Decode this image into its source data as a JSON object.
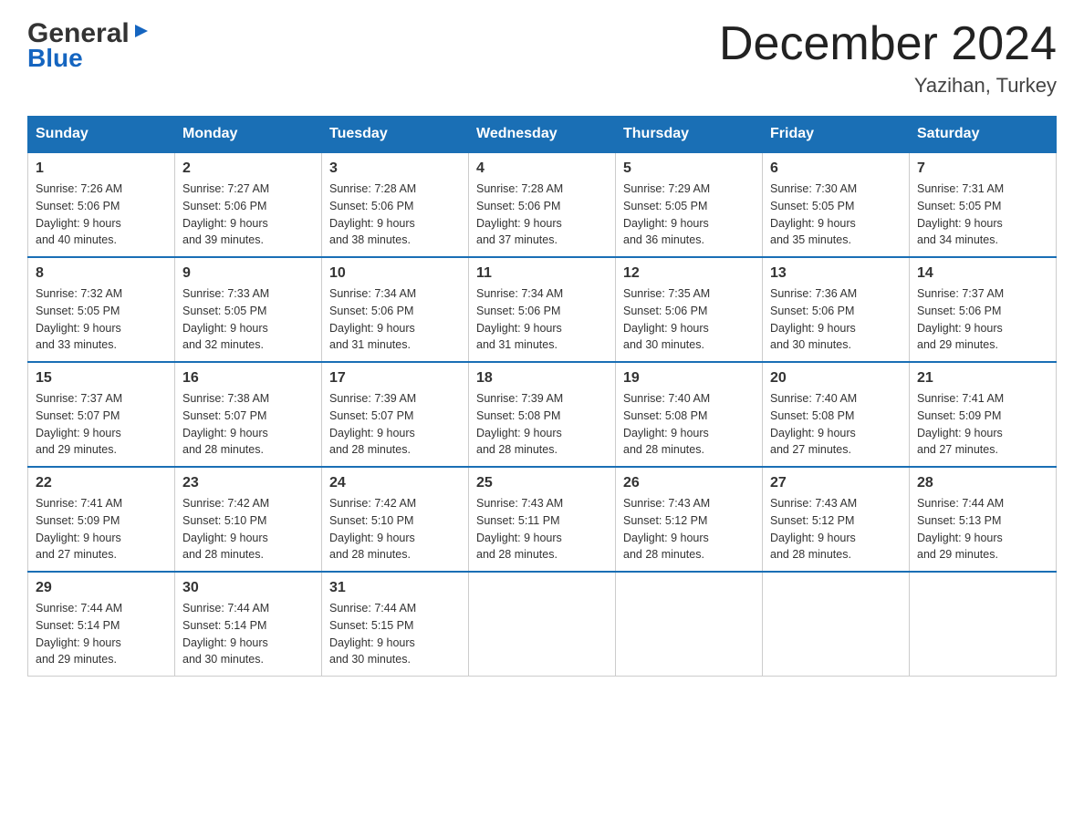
{
  "logo": {
    "general": "General",
    "blue": "Blue"
  },
  "header": {
    "title": "December 2024",
    "subtitle": "Yazihan, Turkey"
  },
  "weekdays": [
    "Sunday",
    "Monday",
    "Tuesday",
    "Wednesday",
    "Thursday",
    "Friday",
    "Saturday"
  ],
  "weeks": [
    [
      {
        "day": "1",
        "sunrise": "7:26 AM",
        "sunset": "5:06 PM",
        "daylight": "9 hours and 40 minutes."
      },
      {
        "day": "2",
        "sunrise": "7:27 AM",
        "sunset": "5:06 PM",
        "daylight": "9 hours and 39 minutes."
      },
      {
        "day": "3",
        "sunrise": "7:28 AM",
        "sunset": "5:06 PM",
        "daylight": "9 hours and 38 minutes."
      },
      {
        "day": "4",
        "sunrise": "7:28 AM",
        "sunset": "5:06 PM",
        "daylight": "9 hours and 37 minutes."
      },
      {
        "day": "5",
        "sunrise": "7:29 AM",
        "sunset": "5:05 PM",
        "daylight": "9 hours and 36 minutes."
      },
      {
        "day": "6",
        "sunrise": "7:30 AM",
        "sunset": "5:05 PM",
        "daylight": "9 hours and 35 minutes."
      },
      {
        "day": "7",
        "sunrise": "7:31 AM",
        "sunset": "5:05 PM",
        "daylight": "9 hours and 34 minutes."
      }
    ],
    [
      {
        "day": "8",
        "sunrise": "7:32 AM",
        "sunset": "5:05 PM",
        "daylight": "9 hours and 33 minutes."
      },
      {
        "day": "9",
        "sunrise": "7:33 AM",
        "sunset": "5:05 PM",
        "daylight": "9 hours and 32 minutes."
      },
      {
        "day": "10",
        "sunrise": "7:34 AM",
        "sunset": "5:06 PM",
        "daylight": "9 hours and 31 minutes."
      },
      {
        "day": "11",
        "sunrise": "7:34 AM",
        "sunset": "5:06 PM",
        "daylight": "9 hours and 31 minutes."
      },
      {
        "day": "12",
        "sunrise": "7:35 AM",
        "sunset": "5:06 PM",
        "daylight": "9 hours and 30 minutes."
      },
      {
        "day": "13",
        "sunrise": "7:36 AM",
        "sunset": "5:06 PM",
        "daylight": "9 hours and 30 minutes."
      },
      {
        "day": "14",
        "sunrise": "7:37 AM",
        "sunset": "5:06 PM",
        "daylight": "9 hours and 29 minutes."
      }
    ],
    [
      {
        "day": "15",
        "sunrise": "7:37 AM",
        "sunset": "5:07 PM",
        "daylight": "9 hours and 29 minutes."
      },
      {
        "day": "16",
        "sunrise": "7:38 AM",
        "sunset": "5:07 PM",
        "daylight": "9 hours and 28 minutes."
      },
      {
        "day": "17",
        "sunrise": "7:39 AM",
        "sunset": "5:07 PM",
        "daylight": "9 hours and 28 minutes."
      },
      {
        "day": "18",
        "sunrise": "7:39 AM",
        "sunset": "5:08 PM",
        "daylight": "9 hours and 28 minutes."
      },
      {
        "day": "19",
        "sunrise": "7:40 AM",
        "sunset": "5:08 PM",
        "daylight": "9 hours and 28 minutes."
      },
      {
        "day": "20",
        "sunrise": "7:40 AM",
        "sunset": "5:08 PM",
        "daylight": "9 hours and 27 minutes."
      },
      {
        "day": "21",
        "sunrise": "7:41 AM",
        "sunset": "5:09 PM",
        "daylight": "9 hours and 27 minutes."
      }
    ],
    [
      {
        "day": "22",
        "sunrise": "7:41 AM",
        "sunset": "5:09 PM",
        "daylight": "9 hours and 27 minutes."
      },
      {
        "day": "23",
        "sunrise": "7:42 AM",
        "sunset": "5:10 PM",
        "daylight": "9 hours and 28 minutes."
      },
      {
        "day": "24",
        "sunrise": "7:42 AM",
        "sunset": "5:10 PM",
        "daylight": "9 hours and 28 minutes."
      },
      {
        "day": "25",
        "sunrise": "7:43 AM",
        "sunset": "5:11 PM",
        "daylight": "9 hours and 28 minutes."
      },
      {
        "day": "26",
        "sunrise": "7:43 AM",
        "sunset": "5:12 PM",
        "daylight": "9 hours and 28 minutes."
      },
      {
        "day": "27",
        "sunrise": "7:43 AM",
        "sunset": "5:12 PM",
        "daylight": "9 hours and 28 minutes."
      },
      {
        "day": "28",
        "sunrise": "7:44 AM",
        "sunset": "5:13 PM",
        "daylight": "9 hours and 29 minutes."
      }
    ],
    [
      {
        "day": "29",
        "sunrise": "7:44 AM",
        "sunset": "5:14 PM",
        "daylight": "9 hours and 29 minutes."
      },
      {
        "day": "30",
        "sunrise": "7:44 AM",
        "sunset": "5:14 PM",
        "daylight": "9 hours and 30 minutes."
      },
      {
        "day": "31",
        "sunrise": "7:44 AM",
        "sunset": "5:15 PM",
        "daylight": "9 hours and 30 minutes."
      },
      null,
      null,
      null,
      null
    ]
  ],
  "labels": {
    "sunrise": "Sunrise:",
    "sunset": "Sunset:",
    "daylight": "Daylight:"
  }
}
